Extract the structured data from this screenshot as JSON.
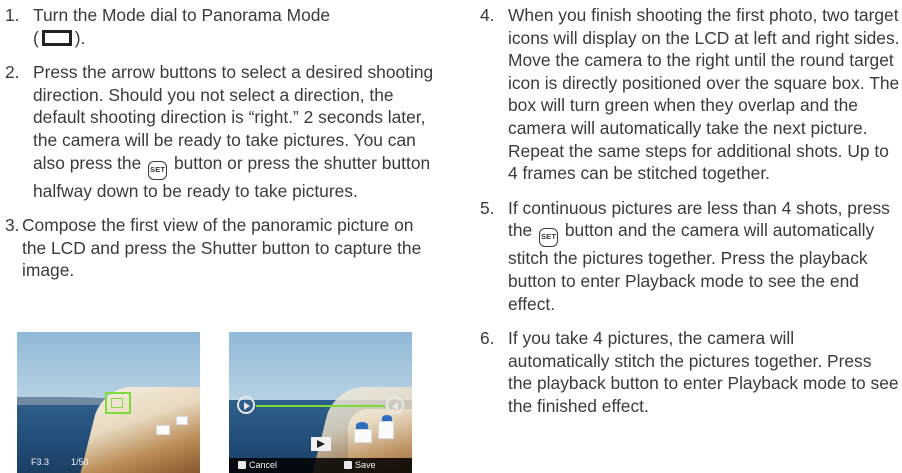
{
  "left_steps": [
    {
      "num": "1.",
      "text_a": "Turn the Mode dial to Panorama Mode",
      "text_b_open": "(",
      "text_b_close": ")."
    },
    {
      "num": "2.",
      "text_a": "Press the arrow buttons to select a desired shooting direction. Should you not select a direction, the default shooting direction is “right.” 2 seconds later, the camera will be ready to take pictures. You can also press the",
      "text_b": "button or press the shutter button halfway down to be ready to take pictures."
    },
    {
      "num": "3.",
      "text": "Compose the first view of the panoramic picture on the LCD and press the Shutter button to capture the image."
    }
  ],
  "right_steps": [
    {
      "num": "4.",
      "text": "When you finish shooting the first photo, two target icons will display on the LCD at left and right sides. Move the camera to the right until the round target icon is directly positioned over the square box. The box will turn green when they overlap and the camera will automatically take the next picture. Repeat the same steps for additional shots. Up to 4 frames can be stitched together."
    },
    {
      "num": "5.",
      "text_a": "If continuous pictures are less than 4 shots, press the",
      "text_b": "button and the camera will automatically stitch the pictures together. Press the playback button to enter Playback mode to see the end effect."
    },
    {
      "num": "6.",
      "text": "If you take 4 pictures, the camera will automatically stitch the pictures together. Press the playback button to enter Playback mode to see the finished effect."
    }
  ],
  "set_button_label": "SET",
  "icons": {
    "panorama": "panorama-mode-icon",
    "set": "set-button-icon"
  },
  "photo_a": {
    "aperture": "F3.3",
    "shutter": "1/50"
  },
  "photo_b": {
    "cancel": "Cancel",
    "save": "Save"
  },
  "colors": {
    "text": "#3b3b3b",
    "focus_green": "#7ddc3a"
  }
}
